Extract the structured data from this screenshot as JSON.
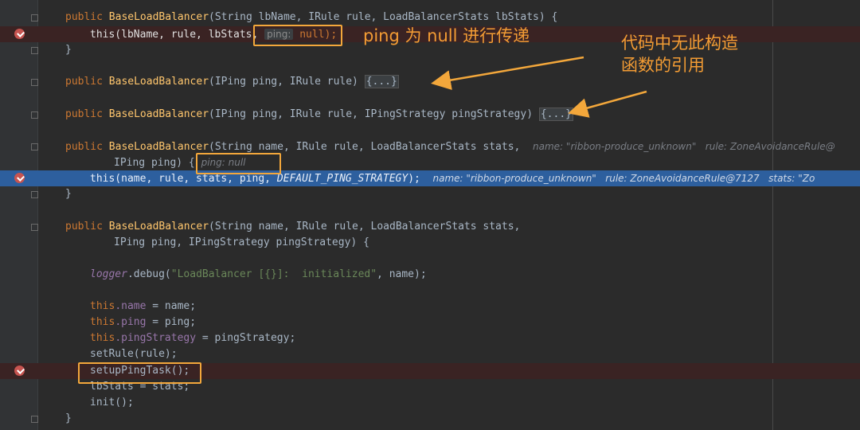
{
  "code": {
    "line1": {
      "kw": "public ",
      "fn": "BaseLoadBalancer",
      "rest": "(String lbName, IRule rule, LoadBalancerStats lbStats) {"
    },
    "line2": {
      "a": "this(lbName, rule, lbStats, ",
      "inlay": "ping:",
      "b": " null);"
    },
    "line3": {
      "t": "}"
    },
    "line4": {
      "kw": "public ",
      "fn": "BaseLoadBalancer",
      "rest": "(IPing ping, IRule rule) ",
      "fold": "{...}"
    },
    "line5": {
      "kw": "public ",
      "fn": "BaseLoadBalancer",
      "rest": "(IPing ping, IRule rule, IPingStrategy pingStrategy) ",
      "fold": "{...}"
    },
    "line6": {
      "kw": "public ",
      "fn": "BaseLoadBalancer",
      "rest": "(String name, IRule rule, LoadBalancerStats stats,",
      "hint": "name: \"ribbon-produce_unknown\"   rule: ZoneAvoidanceRule@"
    },
    "line7": {
      "a": "IPing ping) { ",
      "hint": "ping: null"
    },
    "line8": {
      "a": "this(name, rule, stats, ping, ",
      "const": "DEFAULT_PING_STRATEGY",
      "b": ");",
      "hint": "name: \"ribbon-produce_unknown\"   rule: ZoneAvoidanceRule@7127   stats: \"Zo"
    },
    "line9": {
      "t": "}"
    },
    "line10": {
      "kw": "public ",
      "fn": "BaseLoadBalancer",
      "rest": "(String name, IRule rule, LoadBalancerStats stats,"
    },
    "line11": {
      "t": "IPing ping, IPingStrategy pingStrategy) {"
    },
    "line12": {
      "logger": "logger",
      "a": ".debug(",
      "str": "\"LoadBalancer [{}]:  initialized\"",
      "b": ", name);"
    },
    "line13": {
      "kw": "this",
      "fld": ".name",
      "rest": " = name;"
    },
    "line14": {
      "kw": "this",
      "fld": ".ping",
      "rest": " = ping;"
    },
    "line15": {
      "kw": "this",
      "fld": ".pingStrategy",
      "rest": " = pingStrategy;"
    },
    "line16": {
      "t": "setRule(rule);"
    },
    "line17": {
      "t": "setupPingTask();"
    },
    "line18": {
      "a": "lbStats = stats;"
    },
    "line19": {
      "t": "init();"
    },
    "line20": {
      "t": "}"
    }
  },
  "annotations": {
    "note1": "ping 为 null 进行传递",
    "note2_line1": "代码中无此构造",
    "note2_line2": "函数的引用"
  },
  "colors": {
    "accent": "#f3a73b",
    "exec_line": "#2d5f9e",
    "breakpoint": "#c75450"
  }
}
